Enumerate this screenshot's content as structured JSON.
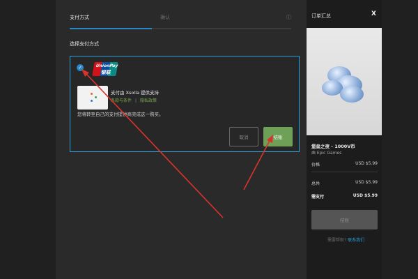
{
  "tabs": {
    "payment_method": "支付方式",
    "confirm": "确认",
    "icon": "ⓘ"
  },
  "section_title": "选择支付方式",
  "payment": {
    "unionpay_text": "UnionPay",
    "unionpay_cn": "银联",
    "provider": "支付由 Xsolla 提供支持",
    "terms_link": "条款与条件",
    "separator": "|",
    "privacy_link": "隐私政策",
    "info_text": "您将转至自己的支付提供商完成这一购买。",
    "cancel_label": "取消",
    "confirm_label": "结账"
  },
  "summary": {
    "title": "订单汇总",
    "close": "X",
    "product_name": "堡垒之夜 - 1000V币",
    "publisher": "由 Epic Games",
    "price_label": "价格",
    "price_value": "USD $5.99",
    "total_label": "总共",
    "total_value": "USD $5.99",
    "pay_label": "需支付",
    "pay_value": "USD $5.99",
    "checkout_label": "结账",
    "help_prefix": "需要帮助?",
    "help_link": "联系我们"
  },
  "colors": {
    "accent": "#2f9fdc",
    "confirm": "#6ea057",
    "arrow": "#d9342b"
  }
}
